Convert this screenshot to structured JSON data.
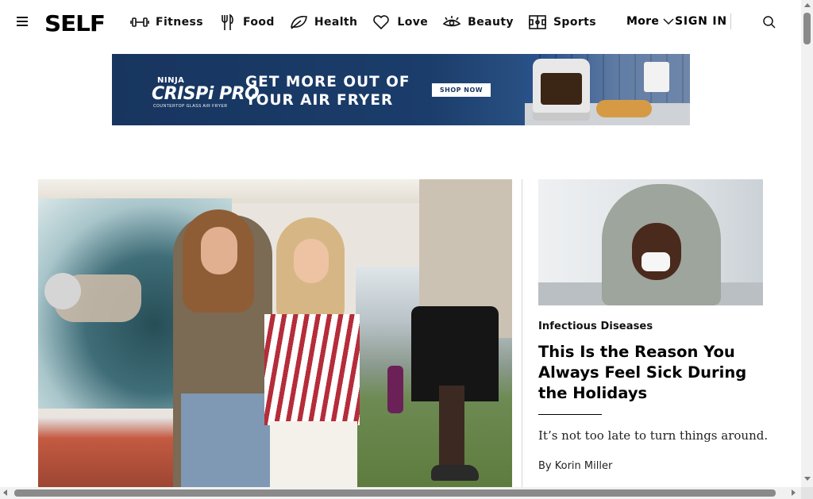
{
  "header": {
    "logo": "SELF",
    "nav": [
      {
        "label": "Fitness",
        "icon": "dumbbell-icon"
      },
      {
        "label": "Food",
        "icon": "fork-knife-icon"
      },
      {
        "label": "Health",
        "icon": "leaf-icon"
      },
      {
        "label": "Love",
        "icon": "heart-icon"
      },
      {
        "label": "Beauty",
        "icon": "eye-lashes-icon"
      },
      {
        "label": "Sports",
        "icon": "field-icon"
      }
    ],
    "more_label": "More",
    "signin_label": "SIGN IN"
  },
  "ad": {
    "brand_small": "NINJA",
    "brand": "CRISPi PRO",
    "brand_sub": "COUNTERTOP GLASS AIR FRYER",
    "headline_line1": "GET MORE OUT OF",
    "headline_line2": "YOUR AIR FRYER",
    "cta": "SHOP NOW"
  },
  "side_story": {
    "category": "Infectious Diseases",
    "headline": "This Is the Reason You Always Feel Sick During the Holidays",
    "dek": "It’s not too late to turn things around.",
    "byline_prefix": "By ",
    "author": "Korin Miller"
  },
  "colors": {
    "text": "#000000",
    "ad_bg": "#17355f",
    "divider": "#d6d6d6"
  }
}
